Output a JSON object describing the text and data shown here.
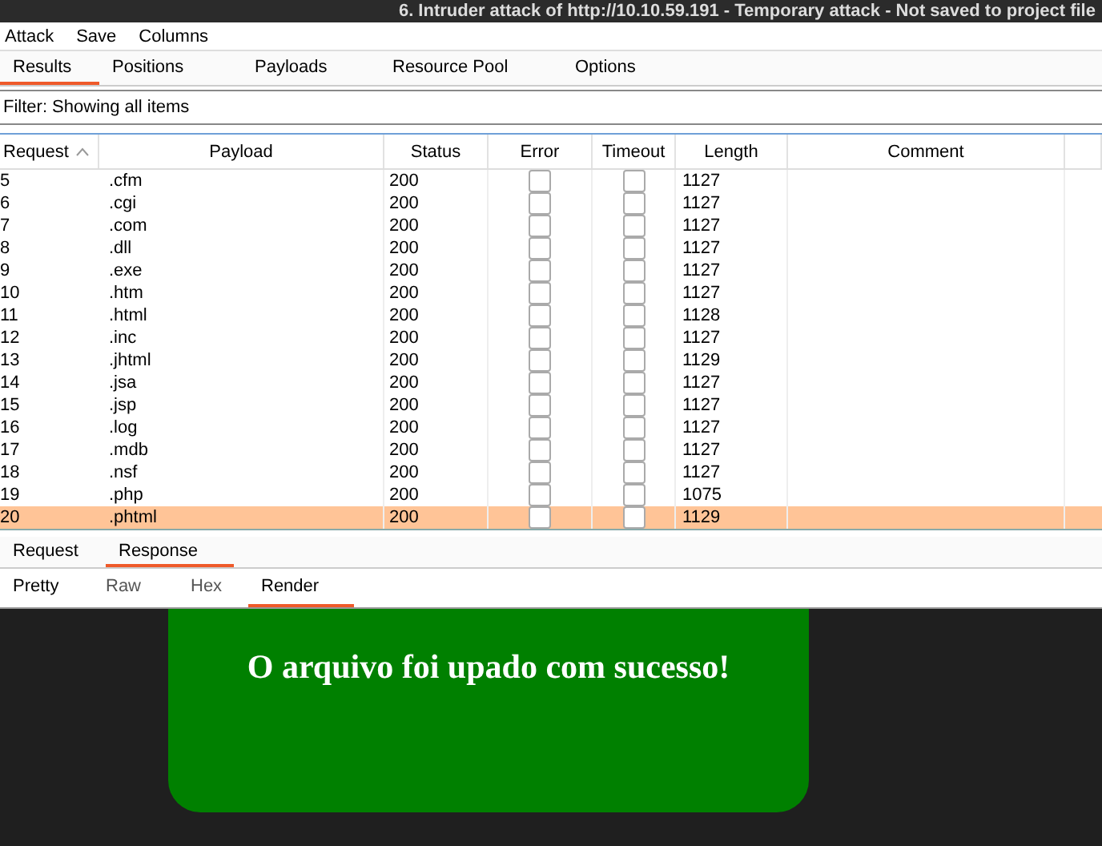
{
  "window": {
    "title": "6. Intruder attack of http://10.10.59.191 - Temporary attack - Not saved to project file"
  },
  "menu": [
    "Attack",
    "Save",
    "Columns"
  ],
  "tabs": [
    {
      "label": "Results",
      "selected": true
    },
    {
      "label": "Positions",
      "selected": false
    },
    {
      "label": "Payloads",
      "selected": false
    },
    {
      "label": "Resource Pool",
      "selected": false
    },
    {
      "label": "Options",
      "selected": false
    }
  ],
  "filter": "Filter: Showing all items",
  "table": {
    "columns": [
      "Request",
      "Payload",
      "Status",
      "Error",
      "Timeout",
      "Length",
      "Comment"
    ],
    "rows": [
      {
        "request": "5",
        "payload": ".cfm",
        "status": "200",
        "error": false,
        "timeout": false,
        "length": "1127",
        "selected": false
      },
      {
        "request": "6",
        "payload": ".cgi",
        "status": "200",
        "error": false,
        "timeout": false,
        "length": "1127",
        "selected": false
      },
      {
        "request": "7",
        "payload": ".com",
        "status": "200",
        "error": false,
        "timeout": false,
        "length": "1127",
        "selected": false
      },
      {
        "request": "8",
        "payload": ".dll",
        "status": "200",
        "error": false,
        "timeout": false,
        "length": "1127",
        "selected": false
      },
      {
        "request": "9",
        "payload": ".exe",
        "status": "200",
        "error": false,
        "timeout": false,
        "length": "1127",
        "selected": false
      },
      {
        "request": "10",
        "payload": ".htm",
        "status": "200",
        "error": false,
        "timeout": false,
        "length": "1127",
        "selected": false
      },
      {
        "request": "11",
        "payload": ".html",
        "status": "200",
        "error": false,
        "timeout": false,
        "length": "1128",
        "selected": false
      },
      {
        "request": "12",
        "payload": ".inc",
        "status": "200",
        "error": false,
        "timeout": false,
        "length": "1127",
        "selected": false
      },
      {
        "request": "13",
        "payload": ".jhtml",
        "status": "200",
        "error": false,
        "timeout": false,
        "length": "1129",
        "selected": false
      },
      {
        "request": "14",
        "payload": ".jsa",
        "status": "200",
        "error": false,
        "timeout": false,
        "length": "1127",
        "selected": false
      },
      {
        "request": "15",
        "payload": ".jsp",
        "status": "200",
        "error": false,
        "timeout": false,
        "length": "1127",
        "selected": false
      },
      {
        "request": "16",
        "payload": ".log",
        "status": "200",
        "error": false,
        "timeout": false,
        "length": "1127",
        "selected": false
      },
      {
        "request": "17",
        "payload": ".mdb",
        "status": "200",
        "error": false,
        "timeout": false,
        "length": "1127",
        "selected": false
      },
      {
        "request": "18",
        "payload": ".nsf",
        "status": "200",
        "error": false,
        "timeout": false,
        "length": "1127",
        "selected": false
      },
      {
        "request": "19",
        "payload": ".php",
        "status": "200",
        "error": false,
        "timeout": false,
        "length": "1075",
        "selected": false
      },
      {
        "request": "20",
        "payload": ".phtml",
        "status": "200",
        "error": false,
        "timeout": false,
        "length": "1129",
        "selected": true
      }
    ]
  },
  "message_tabs": [
    {
      "label": "Request",
      "selected": false
    },
    {
      "label": "Response",
      "selected": true
    }
  ],
  "view_tabs": [
    {
      "label": "Pretty",
      "selected": false
    },
    {
      "label": "Raw",
      "selected": false
    },
    {
      "label": "Hex",
      "selected": false
    },
    {
      "label": "Render",
      "selected": true
    }
  ],
  "render": {
    "message": "O arquivo foi upado com sucesso!"
  }
}
